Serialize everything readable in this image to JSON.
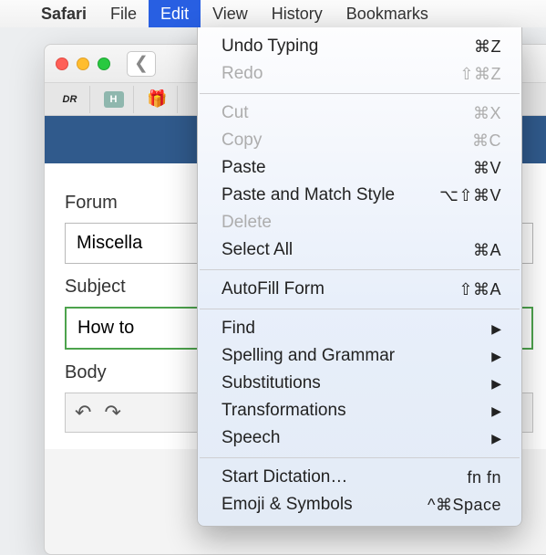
{
  "menubar": {
    "app": "Safari",
    "items": [
      "File",
      "Edit",
      "View",
      "History",
      "Bookmarks"
    ],
    "selected_index": 1
  },
  "edit_menu": {
    "groups": [
      [
        {
          "label": "Undo Typing",
          "shortcut": "⌘Z",
          "disabled": false
        },
        {
          "label": "Redo",
          "shortcut": "⇧⌘Z",
          "disabled": true
        }
      ],
      [
        {
          "label": "Cut",
          "shortcut": "⌘X",
          "disabled": true
        },
        {
          "label": "Copy",
          "shortcut": "⌘C",
          "disabled": true
        },
        {
          "label": "Paste",
          "shortcut": "⌘V",
          "disabled": false
        },
        {
          "label": "Paste and Match Style",
          "shortcut": "⌥⇧⌘V",
          "disabled": false
        },
        {
          "label": "Delete",
          "shortcut": "",
          "disabled": true
        },
        {
          "label": "Select All",
          "shortcut": "⌘A",
          "disabled": false
        }
      ],
      [
        {
          "label": "AutoFill Form",
          "shortcut": "⇧⌘A",
          "disabled": false
        }
      ],
      [
        {
          "label": "Find",
          "submenu": true
        },
        {
          "label": "Spelling and Grammar",
          "submenu": true
        },
        {
          "label": "Substitutions",
          "submenu": true
        },
        {
          "label": "Transformations",
          "submenu": true
        },
        {
          "label": "Speech",
          "submenu": true
        }
      ],
      [
        {
          "label": "Start Dictation…",
          "shortcut": "fn fn"
        },
        {
          "label": "Emoji & Symbols",
          "shortcut": "^⌘Space"
        }
      ]
    ]
  },
  "page": {
    "forum_label": "Forum",
    "forum_value": "Miscella",
    "subject_label": "Subject",
    "subject_value": "How to",
    "body_label": "Body"
  },
  "tabs": {
    "items": [
      {
        "icon": "DR"
      },
      {
        "icon": "H"
      },
      {
        "icon": "gift"
      }
    ]
  }
}
